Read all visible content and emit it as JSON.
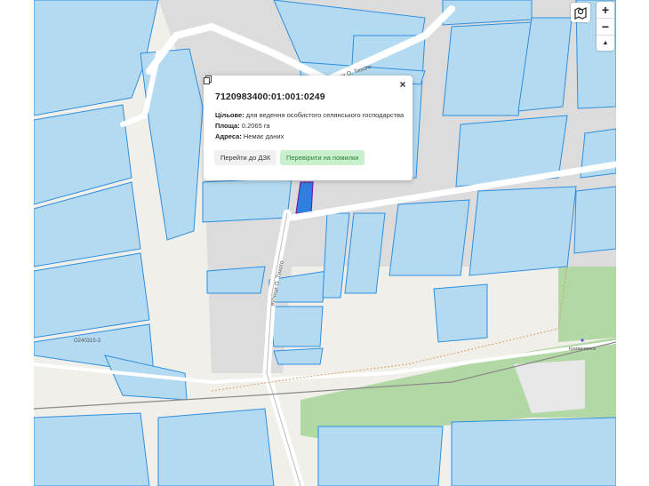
{
  "popup": {
    "cadastral_number": "7120983400:01:001:0249",
    "purpose_label": "Цільове:",
    "purpose_value": "для ведення особистого селянського господарства",
    "area_label": "Площа:",
    "area_value": "0.2065 га",
    "address_label": "Адреса:",
    "address_value": "Немає даних",
    "btn_dzk": "Перейти до ДЗК",
    "btn_check": "Перевірити на помилки",
    "close_symbol": "×",
    "copy_icon": "copy-icon"
  },
  "controls": {
    "zoom_in": "+",
    "zoom_out": "−",
    "compass": "▲",
    "layers_icon": "map-marker-icon"
  },
  "map_labels": {
    "street_vertical": "вулиця О. Тихого",
    "street_top": "вулиця О. Тихого",
    "road_code": "О240315-3",
    "village": "Кривичинка"
  },
  "colors": {
    "parcel_fill": "#b3daf0",
    "parcel_stroke": "#2e8fe0",
    "selected_fill": "#2f7fe0",
    "green_area": "#b2d8a6",
    "button_green": "#c8f0cc"
  }
}
